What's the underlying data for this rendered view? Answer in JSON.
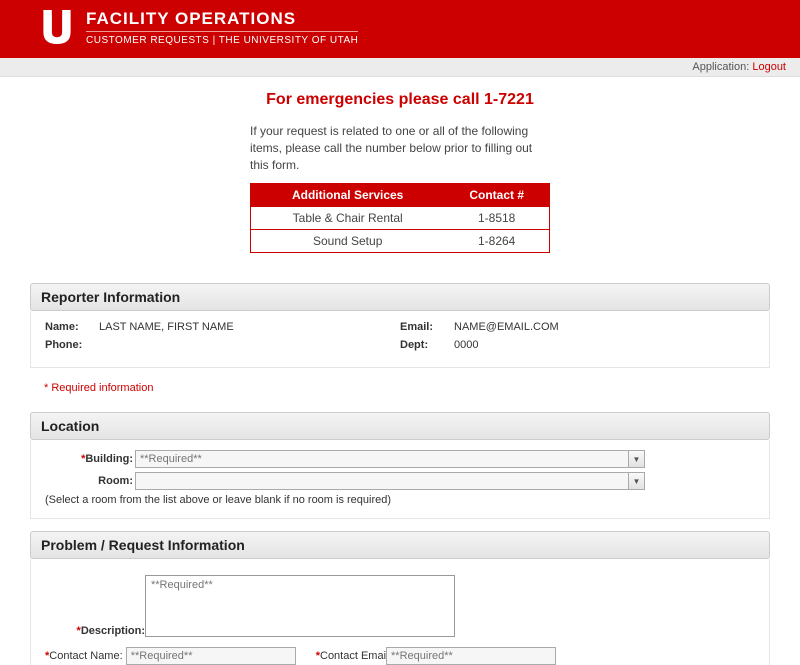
{
  "banner": {
    "title": "FACILITY OPERATIONS",
    "subtitle": "CUSTOMER REQUESTS | THE UNIVERSITY OF UTAH"
  },
  "topbar": {
    "app_label": "Application:",
    "logout_label": "Logout"
  },
  "emergency": "For emergencies please call 1-7221",
  "intro_text": "If your request is related to one or all of the following items, please call the number below prior to filling out this form.",
  "services_table": {
    "head_service": "Additional Services",
    "head_contact": "Contact #",
    "rows": [
      {
        "service": "Table & Chair Rental",
        "contact": "1-8518"
      },
      {
        "service": "Sound Setup",
        "contact": "1-8264"
      }
    ]
  },
  "reporter": {
    "heading": "Reporter Information",
    "name_label": "Name:",
    "name_value": "LAST NAME, FIRST NAME",
    "email_label": "Email:",
    "email_value": "NAME@EMAIL.COM",
    "phone_label": "Phone:",
    "phone_value": "",
    "dept_label": "Dept:",
    "dept_value": "0000"
  },
  "required_note": "* Required information",
  "location": {
    "heading": "Location",
    "building_label": "Building:",
    "building_placeholder": "**Required**",
    "room_label": "Room:",
    "room_placeholder": "",
    "hint": "(Select a room from the list above or leave blank if no room is required)"
  },
  "problem": {
    "heading": "Problem / Request Information",
    "description_label": "Description:",
    "description_placeholder": "**Required**",
    "contact_name_label": "Contact Name:",
    "contact_name_placeholder": "**Required**",
    "contact_email_label": "Contact Emai",
    "contact_email_placeholder": "**Required**"
  }
}
